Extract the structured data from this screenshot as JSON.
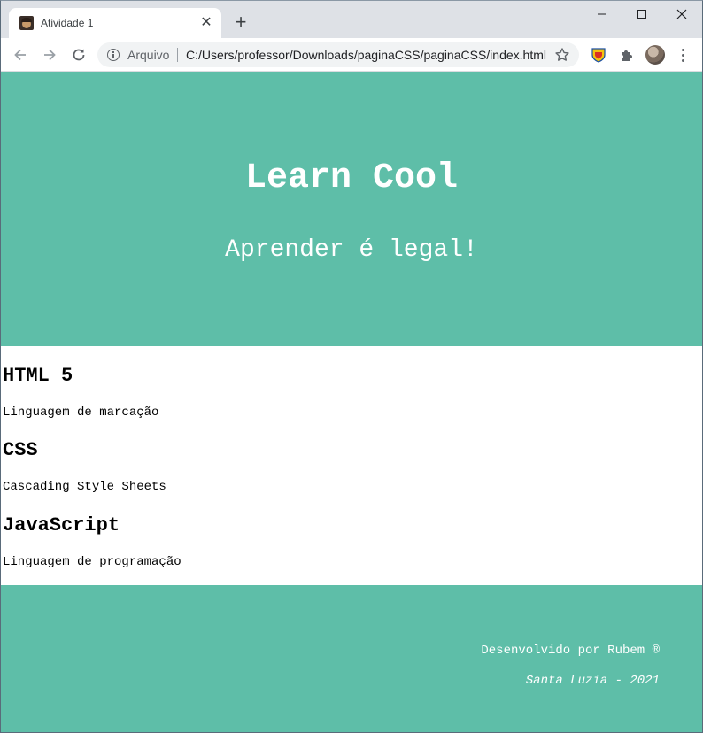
{
  "browser": {
    "tab": {
      "title": "Atividade 1",
      "close_glyph": "✕",
      "favicon": "avatar-favicon"
    },
    "new_tab_glyph": "+",
    "window_controls": [
      "minimize-icon",
      "maximize-icon",
      "close-icon"
    ],
    "omnibox": {
      "scheme_label": "Arquivo",
      "url": "C:/Users/professor/Downloads/paginaCSS/paginaCSS/index.html"
    },
    "extensions": [
      "shield-extension-icon",
      "puzzle-extension-icon"
    ]
  },
  "page": {
    "hero": {
      "title": "Learn Cool",
      "subtitle": "Aprender é legal!"
    },
    "topics": [
      {
        "title": "HTML 5",
        "description": "Linguagem de marcação"
      },
      {
        "title": "CSS",
        "description": "Cascading Style Sheets"
      },
      {
        "title": "JavaScript",
        "description": "Linguagem de programação"
      }
    ],
    "footer": {
      "credit": "Desenvolvido por Rubem ®",
      "place": "Santa Luzia - 2021"
    }
  },
  "colors": {
    "accent": "#5ebea8",
    "tabstrip": "#dee1e6",
    "omnibox": "#f1f3f4"
  }
}
